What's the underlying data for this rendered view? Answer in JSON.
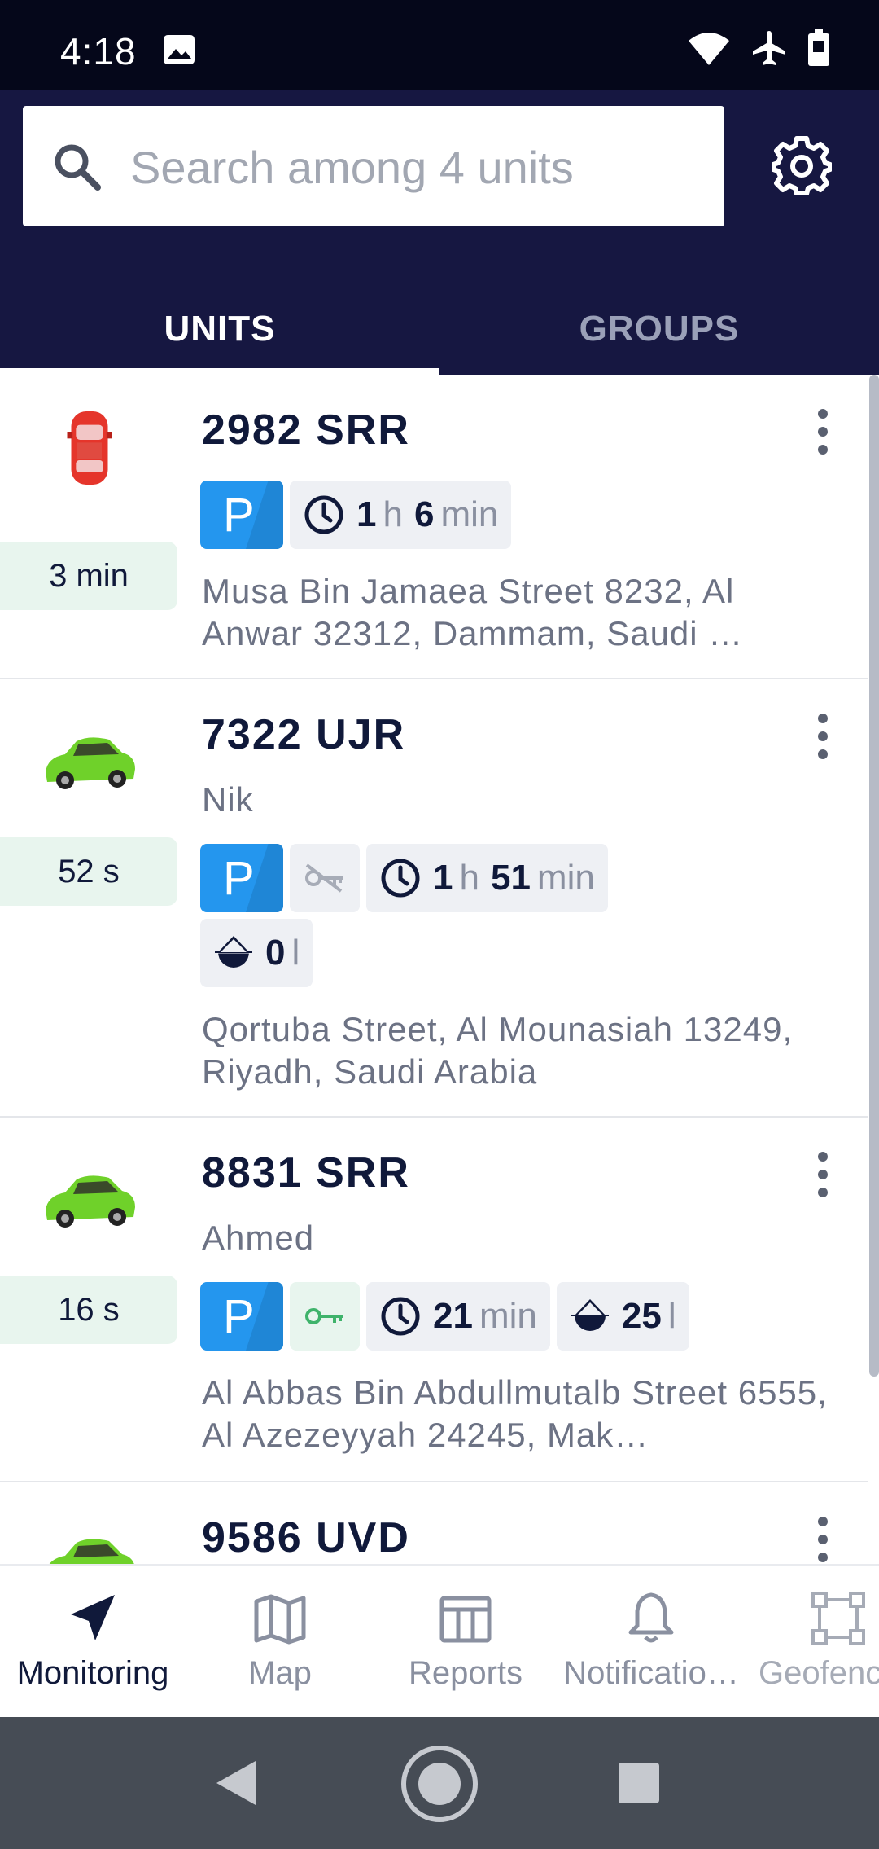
{
  "status_bar": {
    "time": "4:18",
    "icons": [
      "image-icon",
      "wifi-icon",
      "airplane-icon",
      "battery-icon"
    ]
  },
  "search": {
    "placeholder": "Search among 4 units",
    "value": ""
  },
  "tabs": [
    {
      "label": "UNITS",
      "active": true
    },
    {
      "label": "GROUPS",
      "active": false
    }
  ],
  "units": [
    {
      "name": "2982 SRR",
      "icon": "red-car-top-icon",
      "age": "3 min",
      "driver": "",
      "chips": [
        {
          "type": "parking",
          "label": "P"
        },
        {
          "type": "time",
          "icon": "clock-icon",
          "h_value": "1",
          "h_unit": "h",
          "m_value": "6",
          "m_unit": "min"
        }
      ],
      "address": "Musa Bin Jamaea Street 8232, Al Anwar 32312, Dammam, Saudi …"
    },
    {
      "name": "7322 UJR",
      "icon": "green-car-icon",
      "age": "52 s",
      "driver": "Nik",
      "chips": [
        {
          "type": "parking",
          "label": "P"
        },
        {
          "type": "ignition-off",
          "icon": "key-off-icon"
        },
        {
          "type": "time",
          "icon": "clock-icon",
          "h_value": "1",
          "h_unit": "h",
          "m_value": "51",
          "m_unit": "min"
        },
        {
          "type": "fuel",
          "icon": "fuel-icon",
          "value": "0",
          "unit": "l"
        }
      ],
      "address": "Qortuba Street, Al Mounasiah 13249, Riyadh, Saudi Arabia"
    },
    {
      "name": "8831 SRR",
      "icon": "green-car-icon",
      "age": "16 s",
      "driver": "Ahmed",
      "chips": [
        {
          "type": "parking",
          "label": "P"
        },
        {
          "type": "ignition-on",
          "icon": "key-icon"
        },
        {
          "type": "time",
          "icon": "clock-icon",
          "m_value": "21",
          "m_unit": "min"
        },
        {
          "type": "fuel",
          "icon": "fuel-icon",
          "value": "25",
          "unit": "l"
        }
      ],
      "address": "Al Abbas Bin Abdullmutalb Street 6555, Al Azezeyyah 24245, Mak…"
    },
    {
      "name": "9586 UVD",
      "icon": "green-car-icon"
    }
  ],
  "bottom_nav": [
    {
      "label": "Monitoring",
      "icon": "navigation-arrow-icon",
      "active": true
    },
    {
      "label": "Map",
      "icon": "map-icon",
      "active": false
    },
    {
      "label": "Reports",
      "icon": "table-icon",
      "active": false
    },
    {
      "label": "Notificatio…",
      "icon": "bell-icon",
      "active": false
    },
    {
      "label": "Geofences",
      "icon": "geofence-icon",
      "active": false
    }
  ],
  "colors": {
    "header_bg": "#161741",
    "status_bg": "#05071a",
    "parking_blue": "#2496ee",
    "age_bg": "#e8f5ee",
    "key_green": "#3fb36b"
  }
}
